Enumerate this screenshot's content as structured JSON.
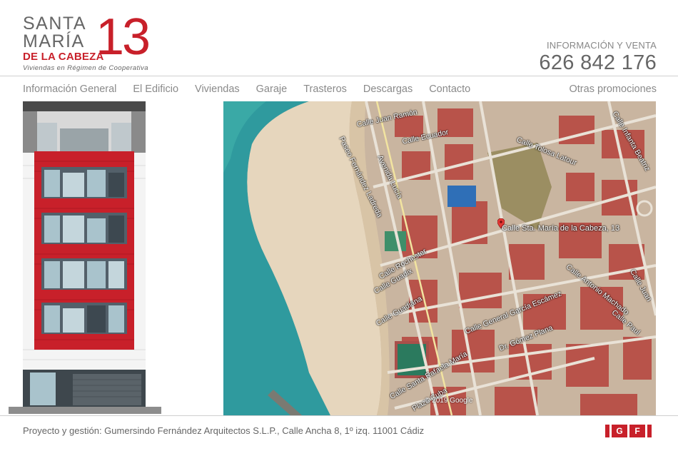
{
  "logo": {
    "line1": "SANTA",
    "line2": "MARÍA",
    "line3": "DE LA CABEZA",
    "number": "13",
    "subtitle": "Viviendas en Régimen de Cooperativa"
  },
  "contact": {
    "info_label": "INFORMACIÓN Y VENTA",
    "phone": "626 842 176"
  },
  "nav": {
    "items": [
      {
        "label": "Información General"
      },
      {
        "label": "El Edificio"
      },
      {
        "label": "Viviendas"
      },
      {
        "label": "Garaje"
      },
      {
        "label": "Trasteros"
      },
      {
        "label": "Descargas"
      },
      {
        "label": "Contacto"
      }
    ],
    "right_label": "Otras promociones"
  },
  "map": {
    "pin_label": "Calle Sta. María de la Cabeza, 13",
    "streets": [
      "Calle Juan Ramón",
      "Calle Ecuador",
      "Calle Tolosa Latour",
      "Paseo Fernández Ladreda",
      "Avenida Lucía",
      "Calle Rochester",
      "Calle Guadix",
      "Calle Guadiana",
      "Calle General García Escámez",
      "Calle Antonio Machado",
      "Calle Juan",
      "Calle Paul",
      "Dr. Gómez Plana",
      "Calle Santa Rafaela María",
      "Plaza Cuba",
      "Calle Infanta Beatriz"
    ],
    "copyright": "© 2019 Google"
  },
  "footer": {
    "text": "Proyecto y gestión: Gumersindo Fernández Arquitectos S.L.P., Calle Ancha 8, 1º izq. 11001 Cádiz",
    "brand_g": "G",
    "brand_f": "F"
  },
  "colors": {
    "brand_red": "#c8202a",
    "text_gray": "#777777",
    "sea": "#2f9a9e",
    "sand": "#e6d6bd"
  }
}
